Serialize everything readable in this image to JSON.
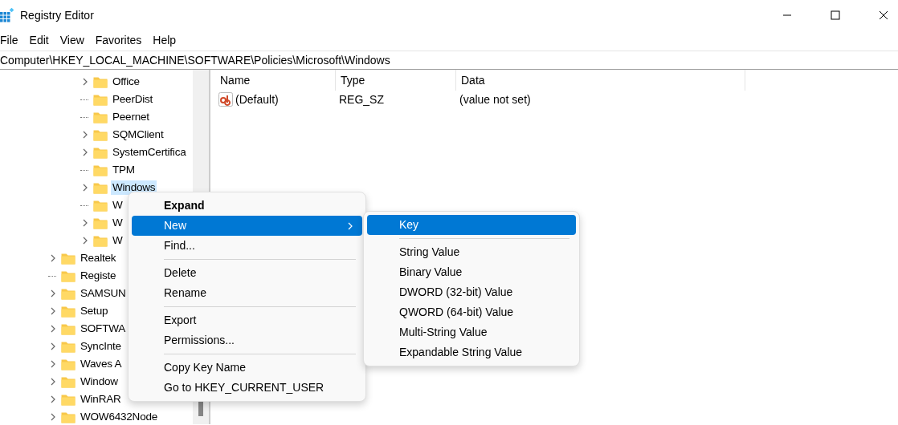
{
  "window": {
    "title": "Registry Editor"
  },
  "menu_bar": [
    "File",
    "Edit",
    "View",
    "Favorites",
    "Help"
  ],
  "address_bar": "Computer\\HKEY_LOCAL_MACHINE\\SOFTWARE\\Policies\\Microsoft\\Windows",
  "tree": {
    "items": [
      {
        "children": [
          {
            "children": [
              {
                "label": "Office",
                "expandable": true,
                "selected": false
              },
              {
                "label": "PeerDist",
                "expandable": false,
                "selected": false
              },
              {
                "label": "Peernet",
                "expandable": false,
                "selected": false
              },
              {
                "label": "SQMClient",
                "expandable": true,
                "selected": false
              },
              {
                "label": "SystemCertifica",
                "expandable": true,
                "selected": false
              },
              {
                "label": "TPM",
                "expandable": false,
                "selected": false
              },
              {
                "label": "Windows",
                "expandable": true,
                "selected": true
              },
              {
                "label": "W",
                "expandable": false,
                "selected": false
              },
              {
                "label": "W",
                "expandable": true,
                "selected": false
              },
              {
                "label": "W",
                "expandable": true,
                "selected": false
              }
            ]
          }
        ]
      },
      {
        "label": "Realtek",
        "expandable": true,
        "selected": false
      },
      {
        "label": "Registe",
        "expandable": false,
        "selected": false
      },
      {
        "label": "SAMSUN",
        "expandable": true,
        "selected": false
      },
      {
        "label": "Setup",
        "expandable": true,
        "selected": false
      },
      {
        "label": "SOFTWA",
        "expandable": true,
        "selected": false
      },
      {
        "label": "SyncInte",
        "expandable": true,
        "selected": false
      },
      {
        "label": "Waves A",
        "expandable": true,
        "selected": false
      },
      {
        "label": "Window",
        "expandable": true,
        "selected": false
      },
      {
        "label": "WinRAR",
        "expandable": true,
        "selected": false
      },
      {
        "label": "WOW6432Node",
        "expandable": true,
        "selected": false
      }
    ]
  },
  "values_table": {
    "columns": [
      "Name",
      "Type",
      "Data"
    ],
    "rows": [
      {
        "name": "(Default)",
        "type": "REG_SZ",
        "data": "(value not set)"
      }
    ]
  },
  "context_menu": [
    {
      "kind": "item",
      "label": "Expand",
      "bold": true,
      "selected": false,
      "has_submenu": false
    },
    {
      "kind": "item",
      "label": "New",
      "bold": false,
      "selected": true,
      "has_submenu": true
    },
    {
      "kind": "item",
      "label": "Find...",
      "bold": false,
      "selected": false,
      "has_submenu": false
    },
    {
      "kind": "separator"
    },
    {
      "kind": "item",
      "label": "Delete",
      "bold": false,
      "selected": false,
      "has_submenu": false
    },
    {
      "kind": "item",
      "label": "Rename",
      "bold": false,
      "selected": false,
      "has_submenu": false
    },
    {
      "kind": "separator"
    },
    {
      "kind": "item",
      "label": "Export",
      "bold": false,
      "selected": false,
      "has_submenu": false
    },
    {
      "kind": "item",
      "label": "Permissions...",
      "bold": false,
      "selected": false,
      "has_submenu": false
    },
    {
      "kind": "separator"
    },
    {
      "kind": "item",
      "label": "Copy Key Name",
      "bold": false,
      "selected": false,
      "has_submenu": false
    },
    {
      "kind": "item",
      "label": "Go to HKEY_CURRENT_USER",
      "bold": false,
      "selected": false,
      "has_submenu": false
    }
  ],
  "submenu": [
    {
      "kind": "item",
      "label": "Key",
      "selected": true
    },
    {
      "kind": "separator"
    },
    {
      "kind": "item",
      "label": "String Value",
      "selected": false
    },
    {
      "kind": "item",
      "label": "Binary Value",
      "selected": false
    },
    {
      "kind": "item",
      "label": "DWORD (32-bit) Value",
      "selected": false
    },
    {
      "kind": "item",
      "label": "QWORD (64-bit) Value",
      "selected": false
    },
    {
      "kind": "item",
      "label": "Multi-String Value",
      "selected": false
    },
    {
      "kind": "item",
      "label": "Expandable String Value",
      "selected": false
    }
  ]
}
